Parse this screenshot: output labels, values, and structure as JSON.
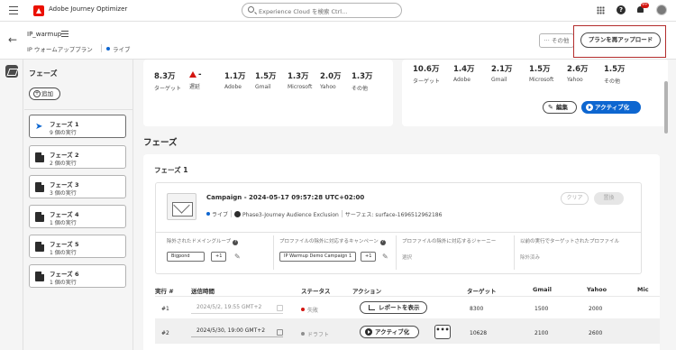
{
  "app": {
    "title": "Adobe Journey Optimizer",
    "search_placeholder": "Experience Cloud を検索 Ctrl...",
    "notification_count": "9+"
  },
  "header": {
    "title": "IP_warmup",
    "subtitle": "IP ウォームアッププラン",
    "status": "ライブ",
    "more_label": "その他",
    "reupload_label": "プランを再アップロード"
  },
  "sidebar": {
    "title": "フェーズ",
    "add_label": "追加",
    "phases": [
      {
        "name": "フェーズ 1",
        "runs": "9 個の実行"
      },
      {
        "name": "フェーズ 2",
        "runs": "2 個の実行"
      },
      {
        "name": "フェーズ 3",
        "runs": "3 個の実行"
      },
      {
        "name": "フェーズ 4",
        "runs": "1 個の実行"
      },
      {
        "name": "フェーズ 5",
        "runs": "1 個の実行"
      },
      {
        "name": "フェーズ 6",
        "runs": "1 個の実行"
      }
    ]
  },
  "summary_left": {
    "stats": [
      {
        "value": "8.3万",
        "label": "ターゲット"
      },
      {
        "value": "-",
        "label": "遅延"
      },
      {
        "value": "1.1万",
        "label": "Adobe"
      },
      {
        "value": "1.5万",
        "label": "Gmail"
      },
      {
        "value": "1.3万",
        "label": "Microsoft"
      },
      {
        "value": "2.0万",
        "label": "Yahoo"
      },
      {
        "value": "1.3万",
        "label": "その他"
      }
    ]
  },
  "summary_right": {
    "stats": [
      {
        "value": "10.6万",
        "label": "ターゲット"
      },
      {
        "value": "1.4万",
        "label": "Adobe"
      },
      {
        "value": "2.1万",
        "label": "Gmail"
      },
      {
        "value": "1.5万",
        "label": "Microsoft"
      },
      {
        "value": "2.6万",
        "label": "Yahoo"
      },
      {
        "value": "1.5万",
        "label": "その他"
      }
    ],
    "edit_label": "編集",
    "activate_label": "アクティブ化"
  },
  "phases_section": {
    "title": "フェーズ",
    "phase_title": "フェーズ 1",
    "campaign": {
      "title": "Campaign - 2024-05-17 09:57:28 UTC+02:00",
      "status": "ライブ",
      "journey": "Phase3-Journey Audience Exclusion",
      "surface": "サーフェス: surface-1696512962186",
      "clear_label": "クリア",
      "replace_label": "置換"
    },
    "columns": [
      {
        "label": "除外されたドメイングループ",
        "tag": "Bigpond",
        "count": "+1"
      },
      {
        "label": "プロファイルの除外に対応するキャンペーン",
        "tag": "IP Warmup Demo Campaign 1",
        "count": "+1"
      },
      {
        "label": "プロファイルの除外に対応するジャーニー",
        "value": "選択"
      },
      {
        "label": "以前の実行でターゲットされたプロファイル",
        "value": "除外済み"
      }
    ],
    "table": {
      "headers": [
        "実行 #",
        "送信時間",
        "ステータス",
        "アクション",
        "ターゲット",
        "Gmail",
        "Yahoo",
        "Mic"
      ],
      "rows": [
        {
          "num": "#1",
          "time": "2024/5/2, 19:55 GMT+2",
          "status": "失敗",
          "action": "レポートを表示",
          "target": "8300",
          "gmail": "1500",
          "yahoo": "2000"
        },
        {
          "num": "#2",
          "time": "2024/5/30, 19:00 GMT+2",
          "status": "ドラフト",
          "action": "アクティブ化",
          "more": "•••",
          "target": "10628",
          "gmail": "2100",
          "yahoo": "2600"
        }
      ]
    }
  },
  "colors": {
    "accent": "#0d66d0",
    "error": "#d31510",
    "draft": "#8e8e8e",
    "highlight": "#b32c2c"
  }
}
